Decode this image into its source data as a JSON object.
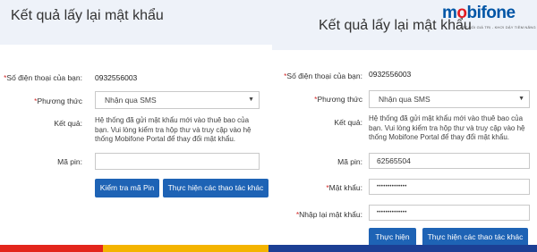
{
  "left": {
    "title": "Kết quả lấy lại mật khẩu",
    "phone_label": "Số điện thoại của bạn:",
    "phone_value": "0932556003",
    "method_label": "Phương thức",
    "method_value": "Nhận qua SMS",
    "result_label": "Kết quả:",
    "result_text": "Hệ thống đã gửi mật khẩu mới vào thuê bao của bạn. Vui lòng kiểm tra hộp thư và truy cập vào hệ thống Mobifone Portal để thay đổi mật khẩu.",
    "pin_label": "Mã pin:",
    "pin_value": "",
    "check_pin_button": "Kiểm tra mã Pin",
    "other_actions_button": "Thực hiện các thao tác khác"
  },
  "right": {
    "title": "Kết quả lấy lại mật khẩu",
    "logo_text_a": "m",
    "logo_text_o": "o",
    "logo_text_b": "bifone",
    "logo_tagline": "KẾT NỐI GIÁ TRỊ - KHƠI DẬY TIỀM NĂNG",
    "phone_label": "Số điện thoại của bạn:",
    "phone_value": "0932556003",
    "method_label": "Phương thức",
    "method_value": "Nhận qua SMS",
    "result_label": "Kết quả:",
    "result_text": "Hệ thống đã gửi mật khẩu mới vào thuê bao của bạn. Vui lòng kiểm tra hộp thư và truy cập vào hệ thống Mobifone Portal để thay đổi mật khẩu.",
    "pin_label": "Mã pin:",
    "pin_value": "62565504",
    "password_label": "Mật khẩu:",
    "password_value": "••••••••••••••",
    "confirm_label": "Nhập lại mật khẩu:",
    "confirm_value": "••••••••••••••",
    "submit_button": "Thực hiện",
    "other_actions_button": "Thực hiện các thao tác khác"
  },
  "required_marker": "*",
  "select_arrow": "▼",
  "colors": {
    "header_bg": "#eef2f9",
    "button_bg": "#1e63b5",
    "required": "#d32b2b",
    "brand_blue": "#0055a6",
    "brand_red": "#e11b22",
    "stripe_red": "#e3261c",
    "stripe_yellow": "#f4b400",
    "stripe_blue": "#1c3f94"
  }
}
